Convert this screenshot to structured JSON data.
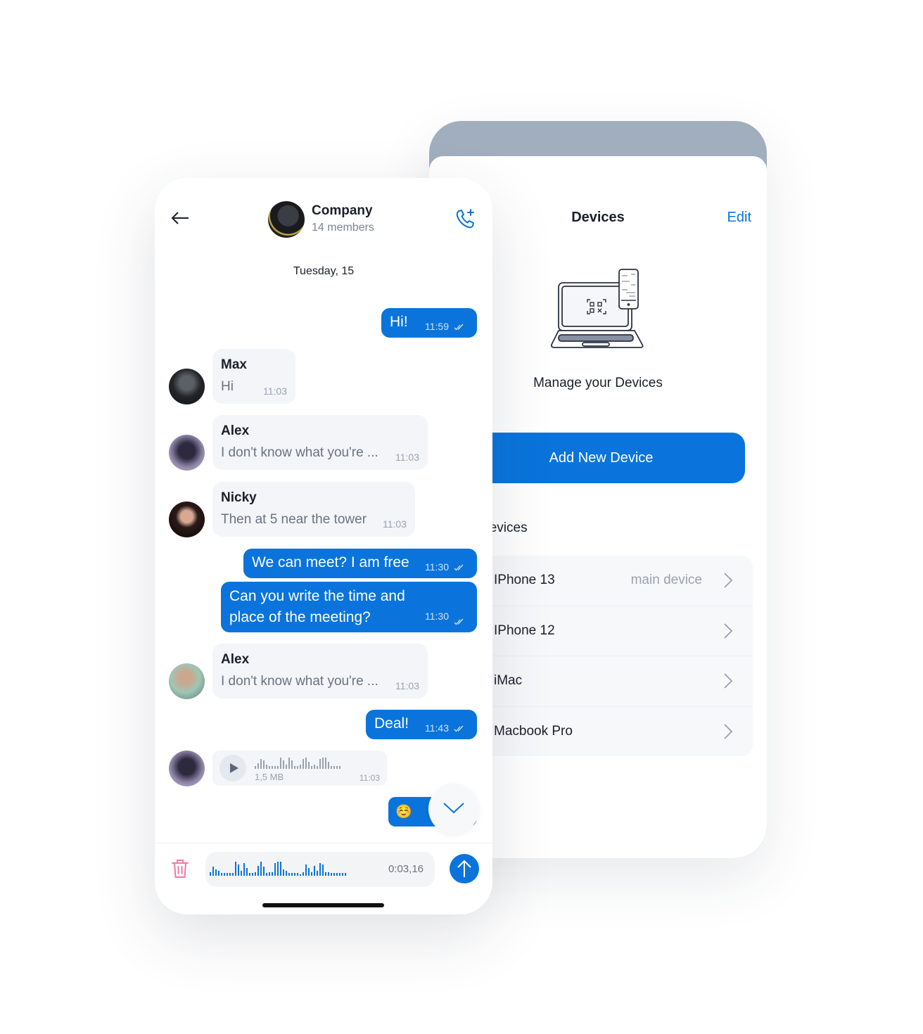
{
  "devices_screen": {
    "title": "Devices",
    "edit_label": "Edit",
    "illustration": "laptop-phone-qr-icon",
    "manage_label": "Manage your Devices",
    "add_button_label": "Add New Device",
    "section_title": "Devices",
    "devices": [
      {
        "name": "IPhone 13",
        "note": "main device"
      },
      {
        "name": "IPhone 12",
        "note": ""
      },
      {
        "name": "iMac",
        "note": ""
      },
      {
        "name": "Macbook Pro",
        "note": ""
      }
    ]
  },
  "chat_screen": {
    "group_name": "Company",
    "members": "14 members",
    "date_label": "Tuesday, 15",
    "messages": [
      {
        "type": "out",
        "text": "Hi!",
        "time": "11:59"
      },
      {
        "type": "in",
        "sender": "Max",
        "text": "Hi",
        "time": "11:03"
      },
      {
        "type": "in",
        "sender": "Alex",
        "text": "I don't know what you're ...",
        "time": "11:03"
      },
      {
        "type": "in",
        "sender": "Nicky",
        "text": "Then at 5 near the tower",
        "time": "11:03"
      },
      {
        "type": "out",
        "text": "We can meet? I am free",
        "time": "11:30"
      },
      {
        "type": "out",
        "text": "Can you write the time and place of the meeting?",
        "time": "11:30"
      },
      {
        "type": "in",
        "sender": "Alex",
        "text": "I don't know what you're ...",
        "time": "11:03"
      },
      {
        "type": "out",
        "text": "Deal!",
        "time": "11:43"
      },
      {
        "type": "voice-in",
        "size": "1,5 MB",
        "time": "11:03"
      },
      {
        "type": "out-emoji",
        "text": "☺️"
      }
    ],
    "composer": {
      "recording_time": "0:03,16"
    }
  },
  "colors": {
    "accent": "#0a74dc",
    "incoming_bubble": "#f3f5f9",
    "delete": "#f07aa0",
    "back_phone_top": "#a0aebe"
  }
}
